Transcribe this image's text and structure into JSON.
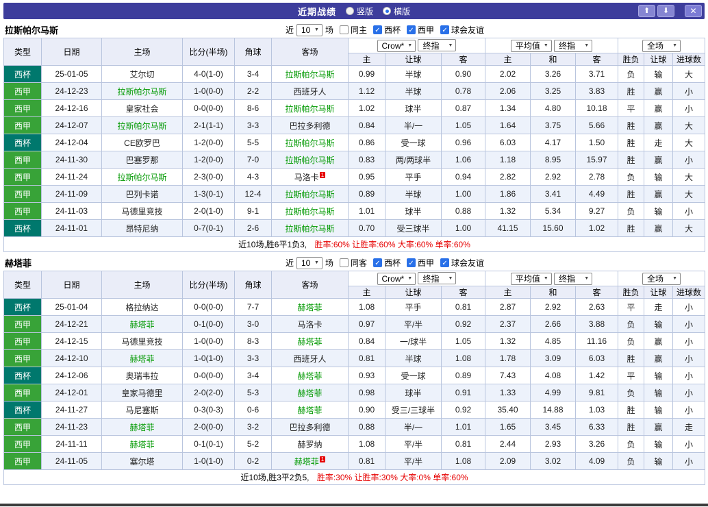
{
  "titlebar": {
    "title": "近期战绩",
    "radios": [
      {
        "label": "竖版",
        "selected": false
      },
      {
        "label": "横版",
        "selected": true
      }
    ]
  },
  "icons": {
    "check": "✓",
    "chevron_down": "▼",
    "arrow_up": "⬆",
    "arrow_down": "⬇",
    "close": "✕"
  },
  "colors": {
    "titlebar": "#3d3d9c",
    "win": "#e60000",
    "lose": "#0000e6",
    "push": "#ff8800",
    "focus_team": "#009900",
    "league_cup": "#00786d",
    "league_liga": "#38a338",
    "checkbox": "#2970e8",
    "header_bg": "#eaedf8",
    "row_alt": "#edf2fb",
    "border": "#b9c5de"
  },
  "filter": {
    "near": "近",
    "count": "10",
    "games": "场",
    "leagues": [
      "西杯",
      "西甲",
      "球会友谊"
    ]
  },
  "table_head": {
    "type": "类型",
    "date": "日期",
    "home": "主场",
    "score": "比分(半场)",
    "corner": "角球",
    "away": "客场",
    "bookmaker": "Crow*",
    "final": "终指",
    "average": "平均值",
    "full": "全场",
    "odds_home": "主",
    "odds_handicap": "让球",
    "odds_away": "客",
    "avg_home": "主",
    "avg_draw": "和",
    "avg_away": "客",
    "result": "胜负",
    "handicap_result": "让球",
    "goals": "进球数"
  },
  "sections": [
    {
      "team": "拉斯帕尔马斯",
      "same_label": "同主",
      "summary": {
        "prefix": "近10场,胜6平1负3,",
        "stats": "胜率:60% 让胜率:60% 大率:60% 单率:60%"
      },
      "rows": [
        {
          "league": "西杯",
          "date": "25-01-05",
          "home": "艾尔切",
          "home_focus": false,
          "score": "4-0(1-0)",
          "corner": "3-4",
          "away": "拉斯帕尔马斯",
          "away_focus": true,
          "odds": [
            "0.99",
            "半球",
            "0.90"
          ],
          "avg": [
            "2.02",
            "3.26",
            "3.71"
          ],
          "results": [
            "负",
            "输",
            "大"
          ]
        },
        {
          "league": "西甲",
          "date": "24-12-23",
          "home": "拉斯帕尔马斯",
          "home_focus": true,
          "score": "1-0(0-0)",
          "corner": "2-2",
          "away": "西班牙人",
          "away_focus": false,
          "odds": [
            "1.12",
            "半球",
            "0.78"
          ],
          "avg": [
            "2.06",
            "3.25",
            "3.83"
          ],
          "results": [
            "胜",
            "赢",
            "小"
          ]
        },
        {
          "league": "西甲",
          "date": "24-12-16",
          "home": "皇家社会",
          "home_focus": false,
          "score": "0-0(0-0)",
          "corner": "8-6",
          "away": "拉斯帕尔马斯",
          "away_focus": true,
          "odds": [
            "1.02",
            "球半",
            "0.87"
          ],
          "avg": [
            "1.34",
            "4.80",
            "10.18"
          ],
          "results": [
            "平",
            "赢",
            "小"
          ]
        },
        {
          "league": "西甲",
          "date": "24-12-07",
          "home": "拉斯帕尔马斯",
          "home_focus": true,
          "score": "2-1(1-1)",
          "corner": "3-3",
          "away": "巴拉多利德",
          "away_focus": false,
          "odds": [
            "0.84",
            "半/一",
            "1.05"
          ],
          "avg": [
            "1.64",
            "3.75",
            "5.66"
          ],
          "results": [
            "胜",
            "赢",
            "大"
          ]
        },
        {
          "league": "西杯",
          "date": "24-12-04",
          "home": "CE欧罗巴",
          "home_focus": false,
          "score": "1-2(0-0)",
          "corner": "5-5",
          "away": "拉斯帕尔马斯",
          "away_focus": true,
          "odds": [
            "0.86",
            "受一球",
            "0.96"
          ],
          "avg": [
            "6.03",
            "4.17",
            "1.50"
          ],
          "results": [
            "胜",
            "走",
            "大"
          ]
        },
        {
          "league": "西甲",
          "date": "24-11-30",
          "home": "巴塞罗那",
          "home_focus": false,
          "score": "1-2(0-0)",
          "corner": "7-0",
          "away": "拉斯帕尔马斯",
          "away_focus": true,
          "odds": [
            "0.83",
            "两/两球半",
            "1.06"
          ],
          "avg": [
            "1.18",
            "8.95",
            "15.97"
          ],
          "results": [
            "胜",
            "赢",
            "小"
          ]
        },
        {
          "league": "西甲",
          "date": "24-11-24",
          "home": "拉斯帕尔马斯",
          "home_focus": true,
          "score": "2-3(0-0)",
          "corner": "4-3",
          "away": "马洛卡",
          "away_focus": false,
          "away_mark": "1",
          "odds": [
            "0.95",
            "平手",
            "0.94"
          ],
          "avg": [
            "2.82",
            "2.92",
            "2.78"
          ],
          "results": [
            "负",
            "输",
            "大"
          ]
        },
        {
          "league": "西甲",
          "date": "24-11-09",
          "home": "巴列卡诺",
          "home_focus": false,
          "score": "1-3(0-1)",
          "corner": "12-4",
          "away": "拉斯帕尔马斯",
          "away_focus": true,
          "odds": [
            "0.89",
            "半球",
            "1.00"
          ],
          "avg": [
            "1.86",
            "3.41",
            "4.49"
          ],
          "results": [
            "胜",
            "赢",
            "大"
          ]
        },
        {
          "league": "西甲",
          "date": "24-11-03",
          "home": "马德里竞技",
          "home_focus": false,
          "score": "2-0(1-0)",
          "corner": "9-1",
          "away": "拉斯帕尔马斯",
          "away_focus": true,
          "odds": [
            "1.01",
            "球半",
            "0.88"
          ],
          "avg": [
            "1.32",
            "5.34",
            "9.27"
          ],
          "results": [
            "负",
            "输",
            "小"
          ]
        },
        {
          "league": "西杯",
          "date": "24-11-01",
          "home": "昂特尼纳",
          "home_focus": false,
          "score": "0-7(0-1)",
          "corner": "2-6",
          "away": "拉斯帕尔马斯",
          "away_focus": true,
          "odds": [
            "0.70",
            "受三球半",
            "1.00"
          ],
          "avg": [
            "41.15",
            "15.60",
            "1.02"
          ],
          "results": [
            "胜",
            "赢",
            "大"
          ]
        }
      ]
    },
    {
      "team": "赫塔菲",
      "same_label": "同客",
      "summary": {
        "prefix": "近10场,胜3平2负5,",
        "stats": "胜率:30% 让胜率:30% 大率:0% 单率:60%"
      },
      "rows": [
        {
          "league": "西杯",
          "date": "25-01-04",
          "home": "格拉纳达",
          "home_focus": false,
          "score": "0-0(0-0)",
          "corner": "7-7",
          "away": "赫塔菲",
          "away_focus": true,
          "odds": [
            "1.08",
            "平手",
            "0.81"
          ],
          "avg": [
            "2.87",
            "2.92",
            "2.63"
          ],
          "results": [
            "平",
            "走",
            "小"
          ]
        },
        {
          "league": "西甲",
          "date": "24-12-21",
          "home": "赫塔菲",
          "home_focus": true,
          "score": "0-1(0-0)",
          "corner": "3-0",
          "away": "马洛卡",
          "away_focus": false,
          "odds": [
            "0.97",
            "平/半",
            "0.92"
          ],
          "avg": [
            "2.37",
            "2.66",
            "3.88"
          ],
          "results": [
            "负",
            "输",
            "小"
          ]
        },
        {
          "league": "西甲",
          "date": "24-12-15",
          "home": "马德里竞技",
          "home_focus": false,
          "score": "1-0(0-0)",
          "corner": "8-3",
          "away": "赫塔菲",
          "away_focus": true,
          "odds": [
            "0.84",
            "一/球半",
            "1.05"
          ],
          "avg": [
            "1.32",
            "4.85",
            "11.16"
          ],
          "results": [
            "负",
            "赢",
            "小"
          ]
        },
        {
          "league": "西甲",
          "date": "24-12-10",
          "home": "赫塔菲",
          "home_focus": true,
          "score": "1-0(1-0)",
          "corner": "3-3",
          "away": "西班牙人",
          "away_focus": false,
          "odds": [
            "0.81",
            "半球",
            "1.08"
          ],
          "avg": [
            "1.78",
            "3.09",
            "6.03"
          ],
          "results": [
            "胜",
            "赢",
            "小"
          ]
        },
        {
          "league": "西杯",
          "date": "24-12-06",
          "home": "奥瑞韦拉",
          "home_focus": false,
          "score": "0-0(0-0)",
          "corner": "3-4",
          "away": "赫塔菲",
          "away_focus": true,
          "odds": [
            "0.93",
            "受一球",
            "0.89"
          ],
          "avg": [
            "7.43",
            "4.08",
            "1.42"
          ],
          "results": [
            "平",
            "输",
            "小"
          ]
        },
        {
          "league": "西甲",
          "date": "24-12-01",
          "home": "皇家马德里",
          "home_focus": false,
          "score": "2-0(2-0)",
          "corner": "5-3",
          "away": "赫塔菲",
          "away_focus": true,
          "odds": [
            "0.98",
            "球半",
            "0.91"
          ],
          "avg": [
            "1.33",
            "4.99",
            "9.81"
          ],
          "results": [
            "负",
            "输",
            "小"
          ]
        },
        {
          "league": "西杯",
          "date": "24-11-27",
          "home": "马尼塞斯",
          "home_focus": false,
          "score": "0-3(0-3)",
          "corner": "0-6",
          "away": "赫塔菲",
          "away_focus": true,
          "odds": [
            "0.90",
            "受三/三球半",
            "0.92"
          ],
          "avg": [
            "35.40",
            "14.88",
            "1.03"
          ],
          "results": [
            "胜",
            "输",
            "小"
          ]
        },
        {
          "league": "西甲",
          "date": "24-11-23",
          "home": "赫塔菲",
          "home_focus": true,
          "score": "2-0(0-0)",
          "corner": "3-2",
          "away": "巴拉多利德",
          "away_focus": false,
          "odds": [
            "0.88",
            "半/一",
            "1.01"
          ],
          "avg": [
            "1.65",
            "3.45",
            "6.33"
          ],
          "results": [
            "胜",
            "赢",
            "走"
          ]
        },
        {
          "league": "西甲",
          "date": "24-11-11",
          "home": "赫塔菲",
          "home_focus": true,
          "score": "0-1(0-1)",
          "corner": "5-2",
          "away": "赫罗纳",
          "away_focus": false,
          "odds": [
            "1.08",
            "平/半",
            "0.81"
          ],
          "avg": [
            "2.44",
            "2.93",
            "3.26"
          ],
          "results": [
            "负",
            "输",
            "小"
          ]
        },
        {
          "league": "西甲",
          "date": "24-11-05",
          "home": "塞尔塔",
          "home_focus": false,
          "score": "1-0(1-0)",
          "corner": "0-2",
          "away": "赫塔菲",
          "away_focus": true,
          "away_mark": "1",
          "odds": [
            "0.81",
            "平/半",
            "1.08"
          ],
          "avg": [
            "2.09",
            "3.02",
            "4.09"
          ],
          "results": [
            "负",
            "输",
            "小"
          ]
        }
      ]
    }
  ]
}
